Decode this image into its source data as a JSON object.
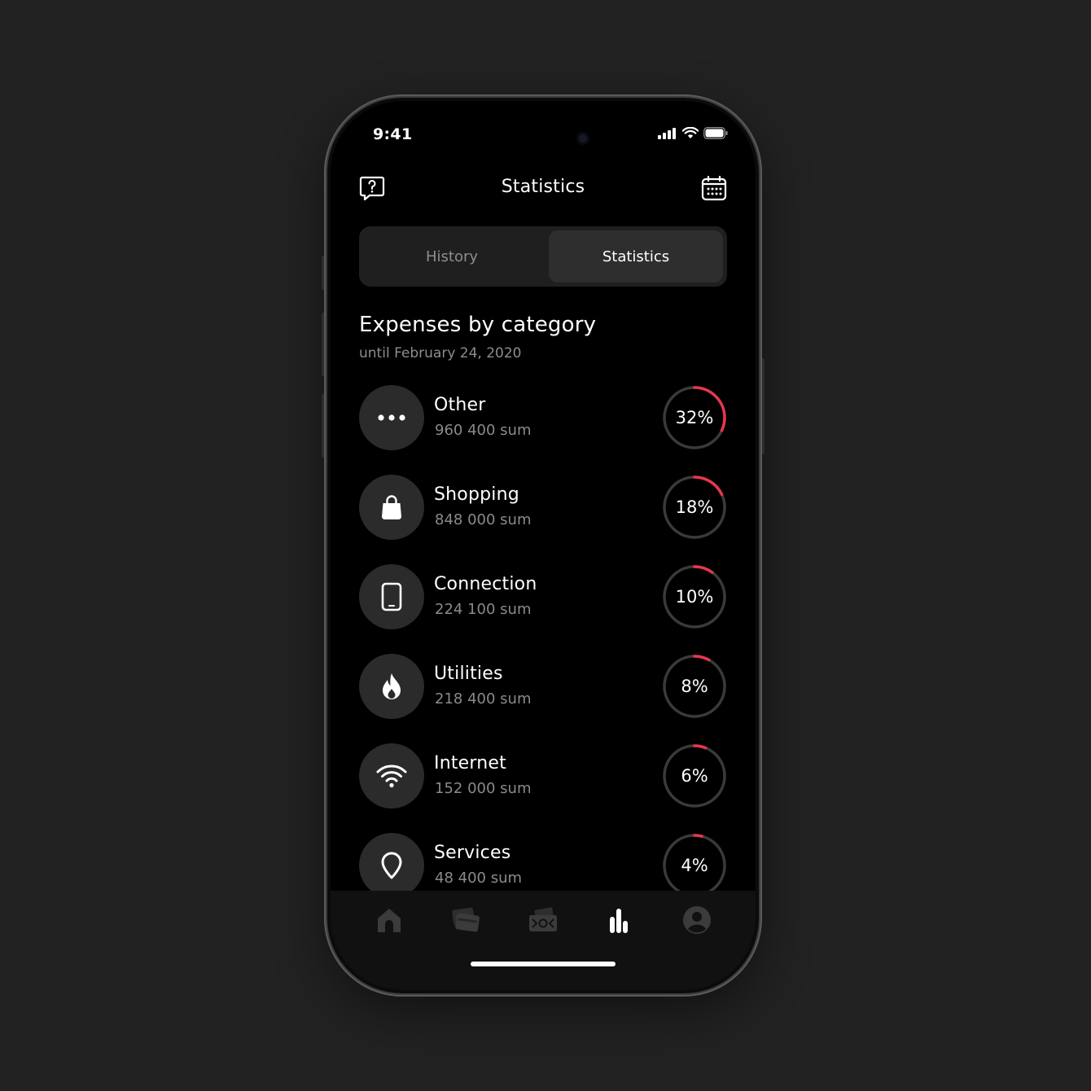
{
  "status_bar": {
    "time": "9:41"
  },
  "header": {
    "title": "Statistics",
    "left_icon": "help-chat-icon",
    "right_icon": "calendar-icon"
  },
  "tabs": [
    {
      "label": "History",
      "active": false
    },
    {
      "label": "Statistics",
      "active": true
    }
  ],
  "section": {
    "title": "Expenses by category",
    "subtitle": "until February 24, 2020"
  },
  "categories": [
    {
      "name": "Other",
      "amount": "960 400 sum",
      "percent_label": "32%",
      "percent": 32,
      "icon": "more-dots-icon"
    },
    {
      "name": "Shopping",
      "amount": "848 000 sum",
      "percent_label": "18%",
      "percent": 18,
      "icon": "shopping-bag-icon"
    },
    {
      "name": "Connection",
      "amount": "224 100 sum",
      "percent_label": "10%",
      "percent": 10,
      "icon": "phone-icon"
    },
    {
      "name": "Utilities",
      "amount": "218 400 sum",
      "percent_label": "8%",
      "percent": 8,
      "icon": "flame-icon"
    },
    {
      "name": "Internet",
      "amount": "152 000 sum",
      "percent_label": "6%",
      "percent": 6,
      "icon": "wifi-icon"
    },
    {
      "name": "Services",
      "amount": "48 400 sum",
      "percent_label": "4%",
      "percent": 4,
      "icon": "location-pin-icon"
    }
  ],
  "bottom_nav": [
    {
      "icon": "home-icon",
      "active": false
    },
    {
      "icon": "cards-icon",
      "active": false
    },
    {
      "icon": "payments-icon",
      "active": false
    },
    {
      "icon": "statistics-icon",
      "active": true
    },
    {
      "icon": "profile-icon",
      "active": false
    }
  ],
  "colors": {
    "accent": "#e8364f",
    "ring_track": "#3a3a3a",
    "background": "#000000",
    "icon_circle": "#2b2b2b"
  }
}
